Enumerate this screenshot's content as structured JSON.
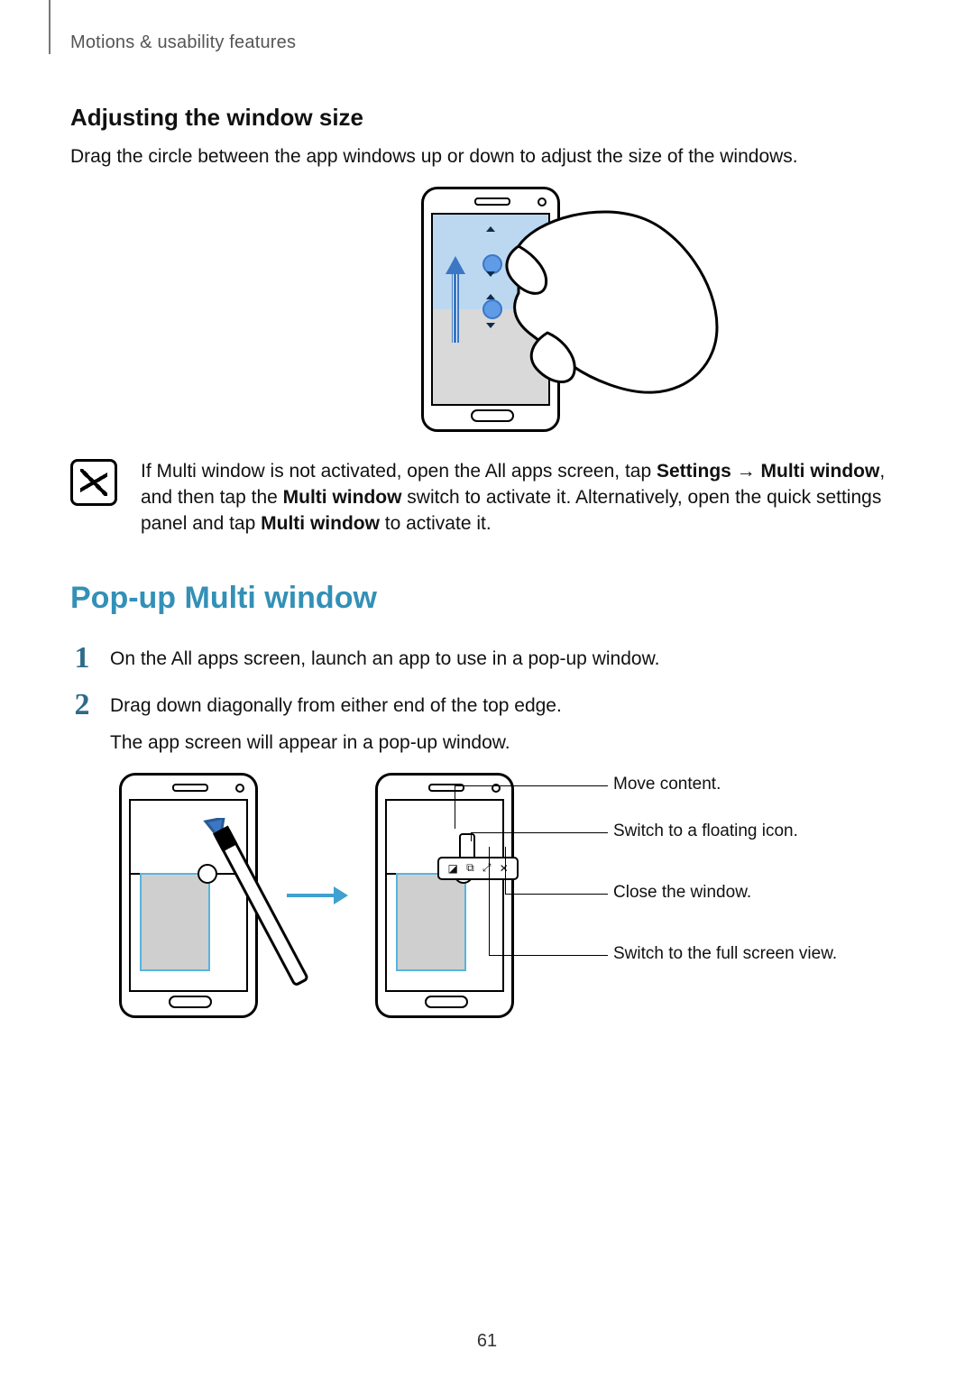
{
  "running_head": "Motions & usability features",
  "section1": {
    "title": "Adjusting the window size",
    "body": "Drag the circle between the app windows up or down to adjust the size of the windows."
  },
  "note": {
    "prefix": "If Multi window is not activated, open the All apps screen, tap ",
    "settings": "Settings",
    "arrow": " → ",
    "mw1": "Multi window",
    "mid1": ", and then tap the ",
    "mw2": "Multi window",
    "mid2": " switch to activate it. Alternatively, open the quick settings panel and tap ",
    "mw3": "Multi window",
    "suffix": " to activate it."
  },
  "section2": {
    "title": "Pop-up Multi window",
    "step1": "On the All apps screen, launch an app to use in a pop-up window.",
    "step2a": "Drag down diagonally from either end of the top edge.",
    "step2b": "The app screen will appear in a pop-up window."
  },
  "callouts": {
    "move": "Move content.",
    "floating": "Switch to a floating icon.",
    "close": "Close the window.",
    "fullscreen": "Switch to the full screen view."
  },
  "nums": {
    "one": "1",
    "two": "2"
  },
  "page_number": "61"
}
